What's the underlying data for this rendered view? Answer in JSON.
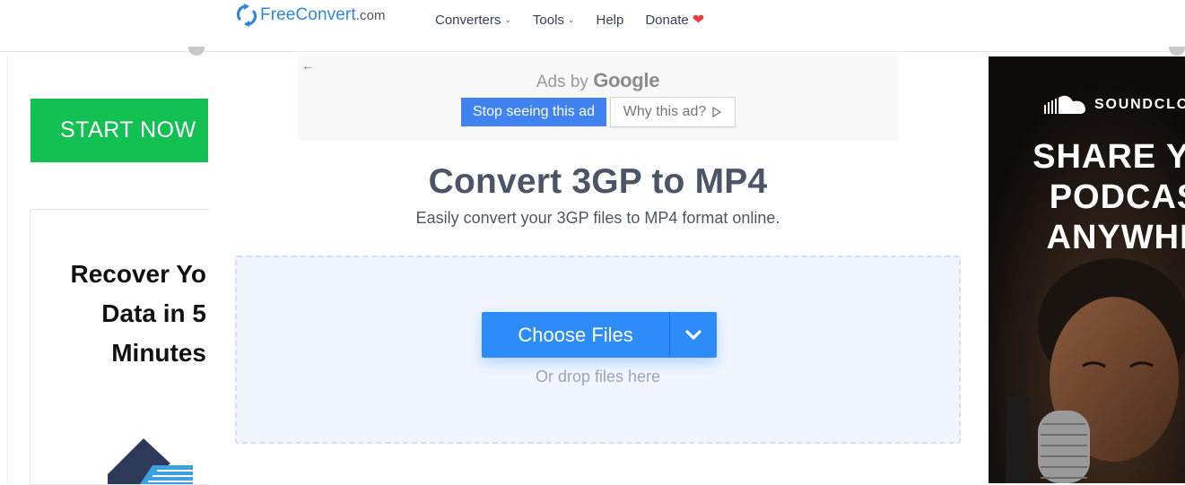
{
  "header": {
    "logo_text": "FreeConvert",
    "logo_suffix": ".com",
    "nav": [
      {
        "label": "Converters",
        "has_dropdown": true
      },
      {
        "label": "Tools",
        "has_dropdown": true
      },
      {
        "label": "Help",
        "has_dropdown": false
      },
      {
        "label": "Donate",
        "has_dropdown": false
      }
    ]
  },
  "google_ad": {
    "ads_by": "Ads by",
    "brand": "Google",
    "stop_label": "Stop seeing this ad",
    "why_label": "Why this ad?"
  },
  "left_ad": {
    "cta": "START NOW",
    "headline": "Recover Yo\nData in 5\nMinutes"
  },
  "main": {
    "title": "Convert 3GP to MP4",
    "subtitle": "Easily convert your 3GP files to MP4 format online.",
    "choose_files_label": "Choose Files",
    "drop_hint": "Or drop files here"
  },
  "right_ad": {
    "brand": "SOUNDCLO",
    "headline": "SHARE YO\nPODCAS\nANYWHE"
  },
  "colors": {
    "brand_blue": "#2e86de",
    "primary_button": "#2d8cf8",
    "start_green": "#12c152",
    "heading": "#4a5568",
    "dropzone_bg": "#f1f6fe"
  }
}
